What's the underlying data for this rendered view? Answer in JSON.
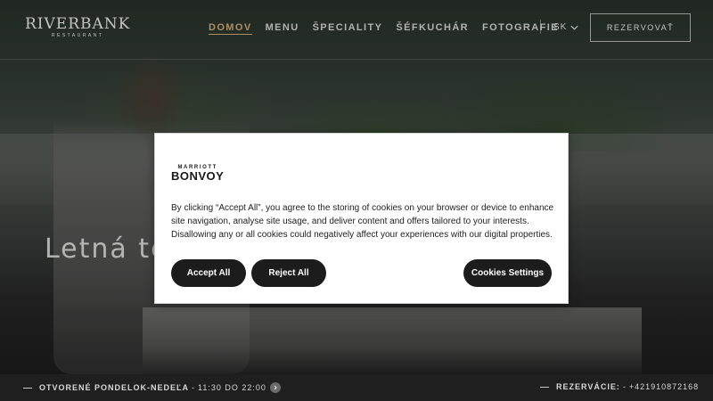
{
  "logo": {
    "name": "RIVERBANK",
    "subtitle": "RESTAURANT"
  },
  "nav": {
    "items": [
      {
        "label": "DOMOV"
      },
      {
        "label": "MENU"
      },
      {
        "label": "ŠPECIALITY"
      },
      {
        "label": "ŠÉFKUCHÁR"
      },
      {
        "label": "FOTOGRAFIE"
      }
    ],
    "active_index": 0,
    "language": "SK",
    "reserve_label": "REZERVOVAŤ"
  },
  "hero": {
    "title": "Letná te"
  },
  "footer": {
    "hours_label": "OTVORENÉ PONDELOK-NEDEĽA",
    "hours_sep": "-",
    "hours_value": "11:30 DO 22:00",
    "reservation_label": "REZERVÁCIE:",
    "reservation_sep": "-",
    "reservation_phone": "+421910872168"
  },
  "cookie_modal": {
    "brand_top": "MARRIOTT",
    "brand_main": "BONVOY",
    "text": "By clicking “Accept All”, you agree to the storing of cookies on your browser or device to enhance site navigation, analyse site usage, and deliver content and offers tailored to your interests. Disallowing any or all cookies could negatively affect your experiences with our digital properties.",
    "accept_label": "Accept All",
    "reject_label": "Reject All",
    "settings_label": "Cookies Settings"
  },
  "colors": {
    "accent": "#c9a97a",
    "button_dark": "#1c1c1c",
    "footer_bg": "#1f1f1f"
  }
}
